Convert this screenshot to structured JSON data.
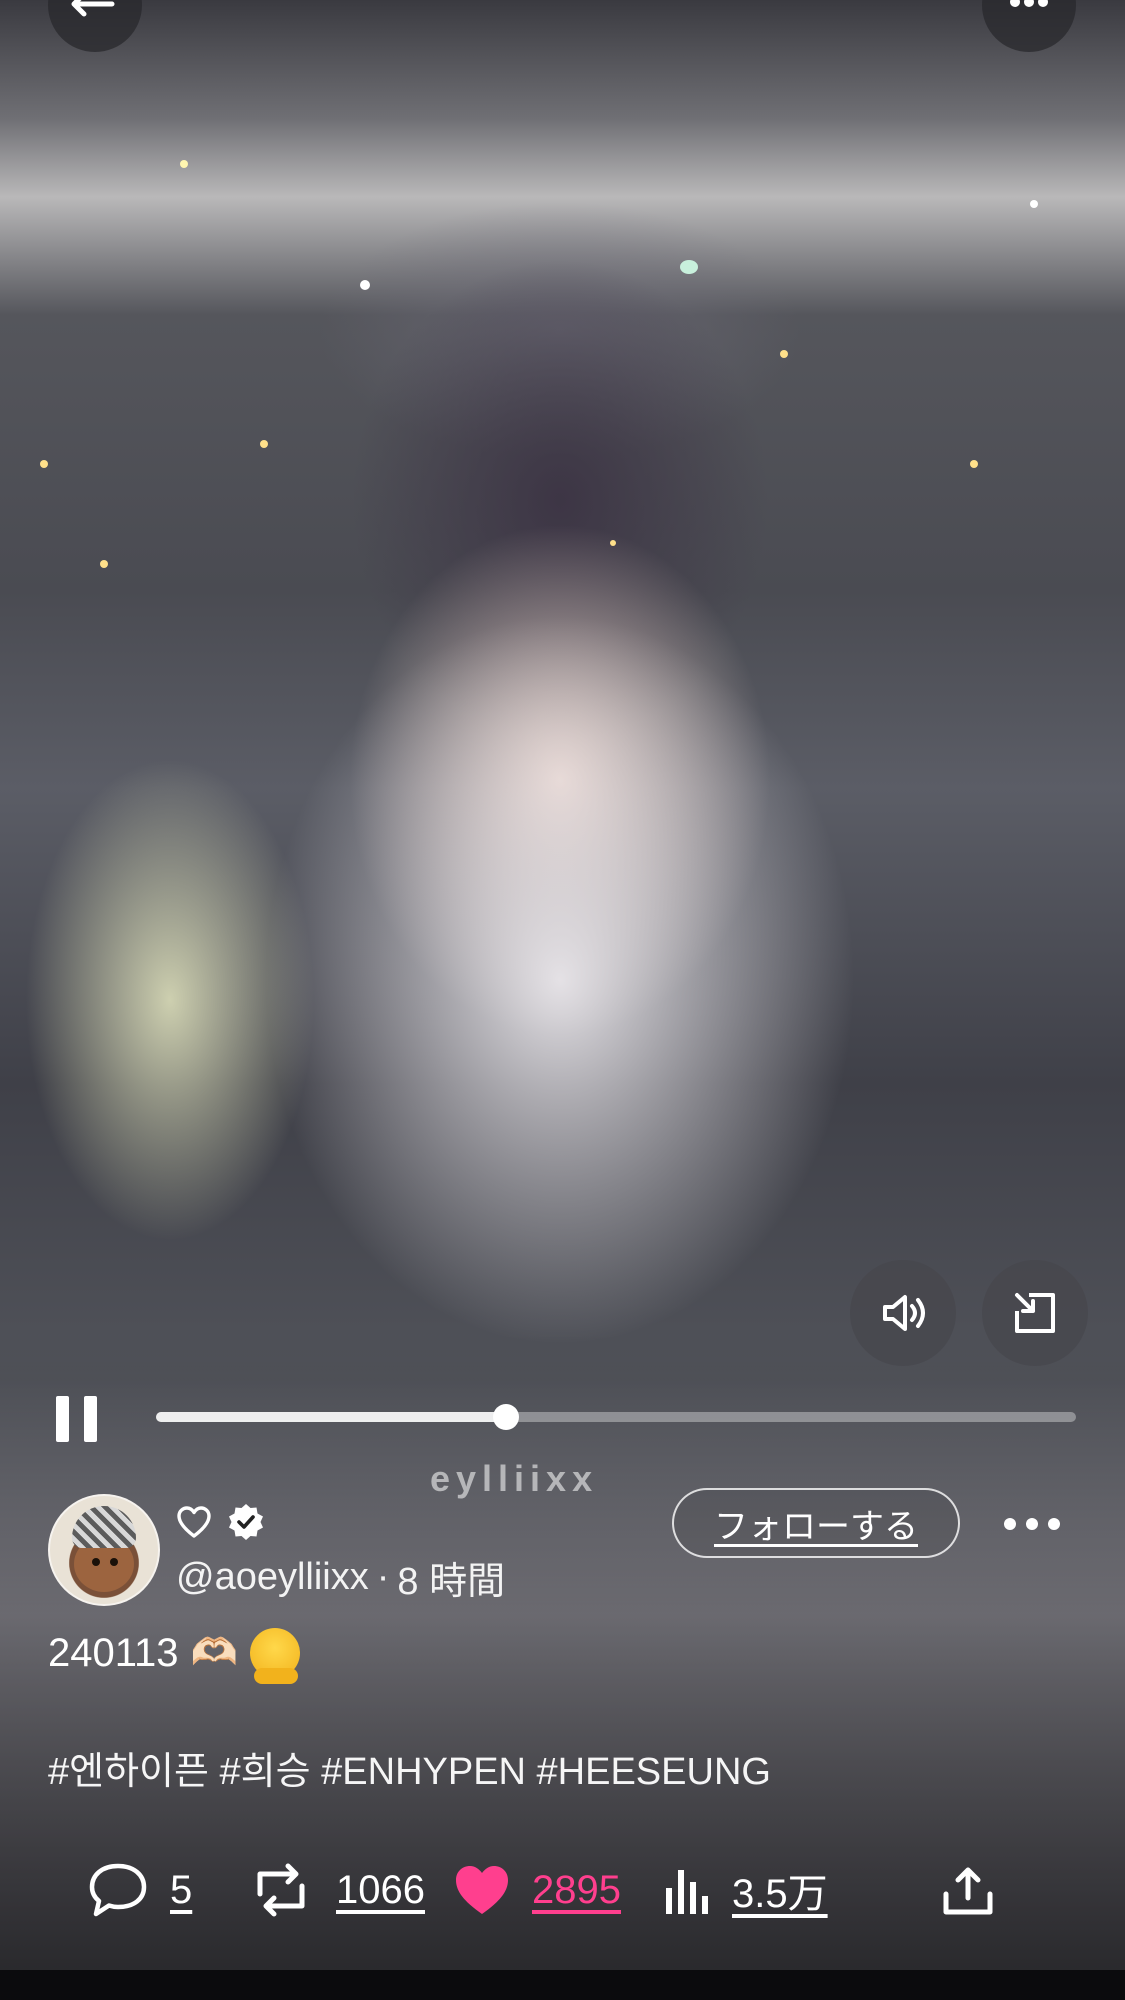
{
  "video": {
    "watermark": "eylliixx",
    "progress_fraction": 0.38
  },
  "controls": {
    "back_icon": "arrow-left-icon",
    "more_icon": "ellipsis-icon",
    "volume_icon": "speaker-icon",
    "pip_icon": "minimize-window-icon",
    "pause_icon": "pause-icon"
  },
  "post": {
    "handle": "@aoeylliixx",
    "separator": "·",
    "time": "8 時間",
    "follow_label": "フォローする",
    "caption_text": "240113",
    "caption_emoji_heart": "🫶🏻",
    "hashtags": "#엔하이픈 #희승 #ENHYPEN #HEESEUNG"
  },
  "actions": {
    "replies": "5",
    "reposts": "1066",
    "likes": "2895",
    "views": "3.5万"
  },
  "colors": {
    "like": "#ff3f8e",
    "text": "#ffffff"
  }
}
